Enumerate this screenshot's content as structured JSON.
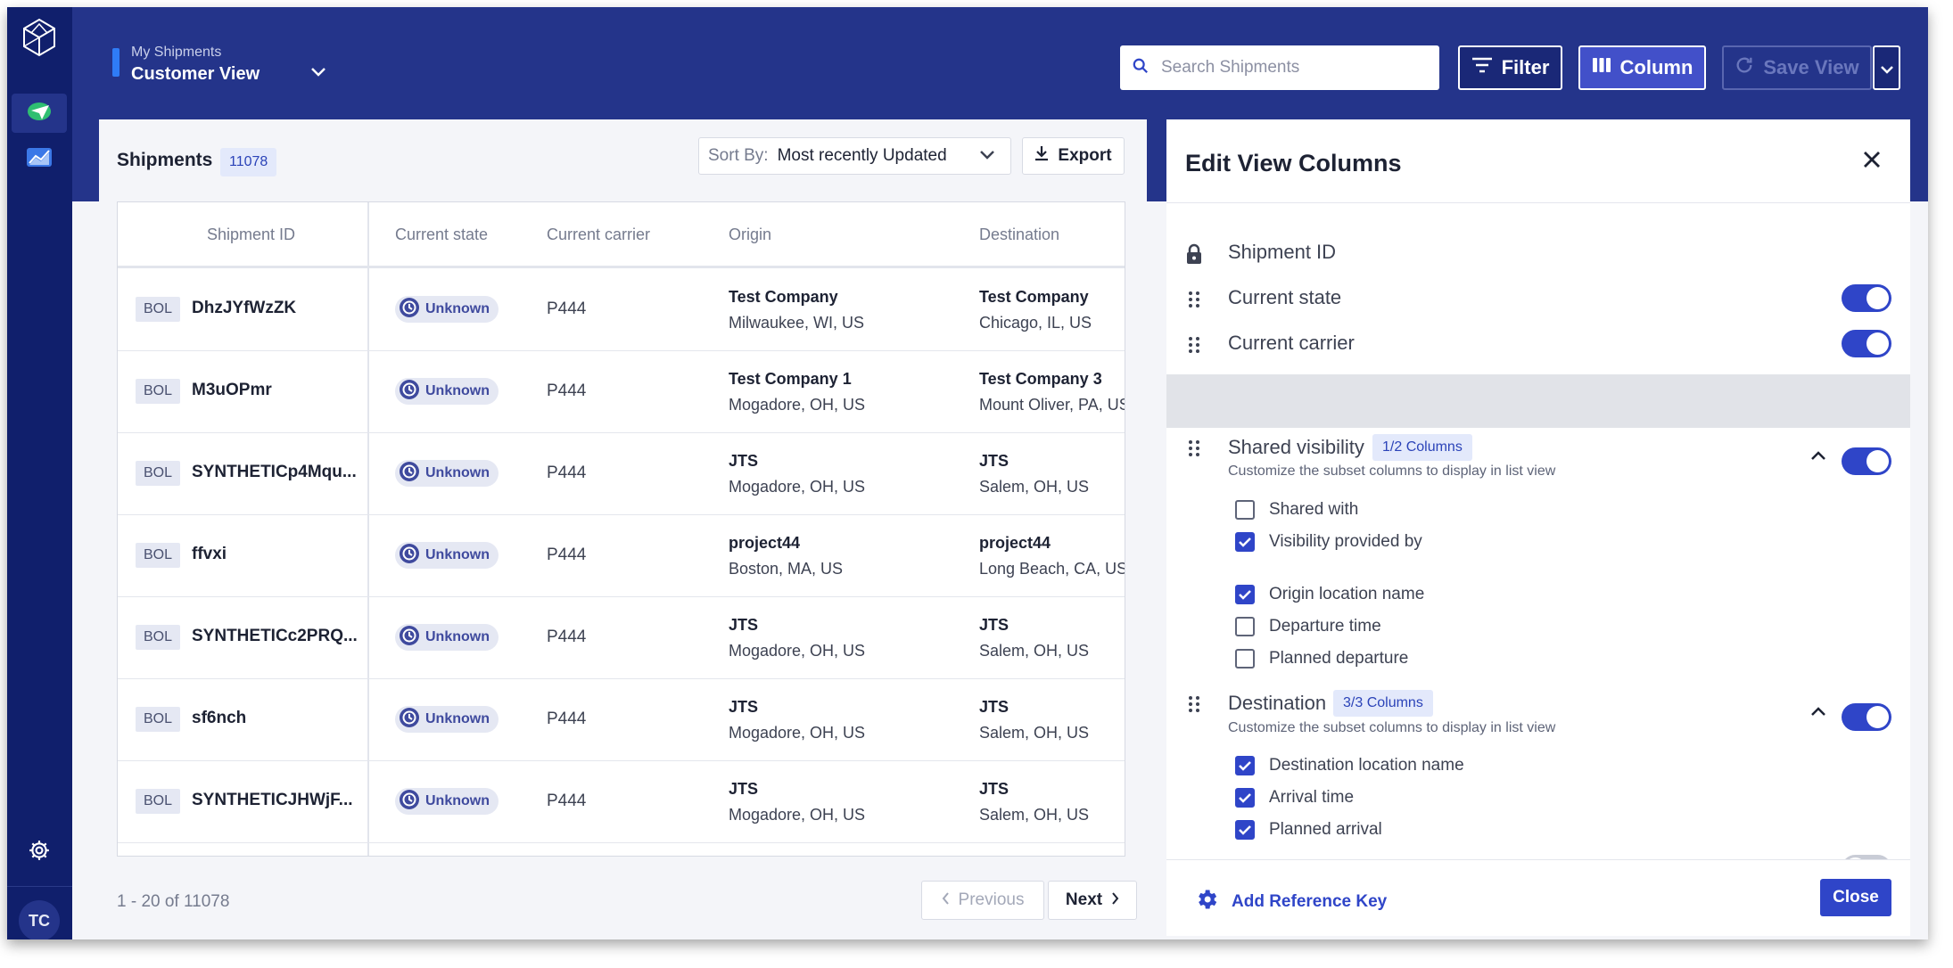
{
  "header": {
    "view_small": "My Shipments",
    "view_title": "Customer View",
    "search_placeholder": "Search Shipments",
    "filter_label": "Filter",
    "column_label": "Column",
    "save_view_label": "Save View"
  },
  "sidebar": {
    "avatar_initials": "TC",
    "items": [
      {
        "icon": "shipments-icon",
        "active": true
      },
      {
        "icon": "analytics-icon",
        "active": false
      }
    ]
  },
  "shipments": {
    "title": "Shipments",
    "count": "11078",
    "sort_label": "Sort By:",
    "sort_value": "Most recently Updated",
    "export_label": "Export",
    "columns": [
      "Shipment ID",
      "Current state",
      "Current carrier",
      "Origin",
      "Destination"
    ],
    "rows": [
      {
        "bol": "BOL",
        "id": "DhzJYfWzZK",
        "state": "Unknown",
        "carrier": "P444",
        "origin_name": "Test Company",
        "origin_city": "Milwaukee, WI, US",
        "dest_name": "Test Company",
        "dest_city": "Chicago, IL, US"
      },
      {
        "bol": "BOL",
        "id": "M3uOPmr",
        "state": "Unknown",
        "carrier": "P444",
        "origin_name": "Test Company 1",
        "origin_city": "Mogadore, OH, US",
        "dest_name": "Test Company 3",
        "dest_city": "Mount Oliver, PA, US"
      },
      {
        "bol": "BOL",
        "id": "SYNTHETICp4Mqu...",
        "state": "Unknown",
        "carrier": "P444",
        "origin_name": "JTS",
        "origin_city": "Mogadore, OH, US",
        "dest_name": "JTS",
        "dest_city": "Salem, OH, US"
      },
      {
        "bol": "BOL",
        "id": "ffvxi",
        "state": "Unknown",
        "carrier": "P444",
        "origin_name": "project44",
        "origin_city": "Boston, MA, US",
        "dest_name": "project44",
        "dest_city": "Long Beach, CA, US"
      },
      {
        "bol": "BOL",
        "id": "SYNTHETICc2PRQ...",
        "state": "Unknown",
        "carrier": "P444",
        "origin_name": "JTS",
        "origin_city": "Mogadore, OH, US",
        "dest_name": "JTS",
        "dest_city": "Salem, OH, US"
      },
      {
        "bol": "BOL",
        "id": "sf6nch",
        "state": "Unknown",
        "carrier": "P444",
        "origin_name": "JTS",
        "origin_city": "Mogadore, OH, US",
        "dest_name": "JTS",
        "dest_city": "Salem, OH, US"
      },
      {
        "bol": "BOL",
        "id": "SYNTHETICJHWjF...",
        "state": "Unknown",
        "carrier": "P444",
        "origin_name": "JTS",
        "origin_city": "Mogadore, OH, US",
        "dest_name": "JTS",
        "dest_city": "Salem, OH, US"
      }
    ],
    "pagination_text": "1 - 20 of 11078",
    "previous_label": "Previous",
    "next_label": "Next"
  },
  "edit_panel": {
    "title": "Edit View Columns",
    "fixed_column": "Shipment ID",
    "columns": [
      {
        "label": "Current state",
        "enabled": true
      },
      {
        "label": "Current carrier",
        "enabled": true
      }
    ],
    "groups": [
      {
        "title": "Shared visibility",
        "badge": "1/2 Columns",
        "subtitle": "Customize the subset columns to display in list view",
        "enabled": true,
        "options": [
          {
            "label": "Shared with",
            "checked": false
          },
          {
            "label": "Visibility provided by",
            "checked": true
          },
          {
            "label": "Origin location name",
            "checked": true
          },
          {
            "label": "Departure time",
            "checked": false
          },
          {
            "label": "Planned departure",
            "checked": false
          }
        ]
      },
      {
        "title": "Destination",
        "badge": "3/3 Columns",
        "subtitle": "Customize the subset columns to display in list view",
        "enabled": true,
        "options": [
          {
            "label": "Destination location name",
            "checked": true
          },
          {
            "label": "Arrival time",
            "checked": true
          },
          {
            "label": "Planned arrival",
            "checked": true
          }
        ]
      }
    ],
    "add_reference_label": "Add Reference Key",
    "close_label": "Close"
  },
  "colors": {
    "sidebar": "#101f6c",
    "header": "#24348a",
    "accent": "#2f45c8",
    "status_unknown": "#3f4a9e"
  }
}
